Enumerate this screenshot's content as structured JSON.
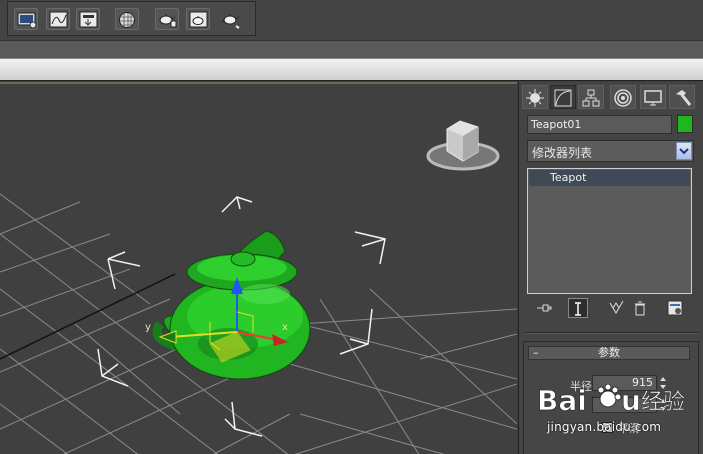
{
  "toolbar": {
    "buttons": [
      {
        "name": "layer-manager-icon"
      },
      {
        "name": "curve-editor-icon"
      },
      {
        "name": "schematic-view-icon"
      },
      {
        "name": "material-editor-icon"
      },
      {
        "name": "render-setup-icon"
      },
      {
        "name": "rendered-frame-window-icon"
      },
      {
        "name": "quick-render-icon"
      }
    ]
  },
  "panel": {
    "tabs": [
      "create",
      "modify",
      "hierarchy",
      "motion",
      "display",
      "utilities"
    ],
    "object_name": "Teapot01",
    "object_color": "#1fb71f",
    "modifier_list": "修改器列表",
    "stack_items": [
      "Teapot"
    ],
    "params_title": "参数",
    "radius_label": "半径",
    "radius_value": "915",
    "smooth_label": "平滑"
  },
  "viewport": {
    "axis_x": "x",
    "axis_y": "y",
    "object_color": "#22b522",
    "grid_color": "#8a8a8a",
    "background": "#404040"
  },
  "watermark": {
    "logo_text": "Baidu经验",
    "url": "jingyan.baidu.com"
  }
}
